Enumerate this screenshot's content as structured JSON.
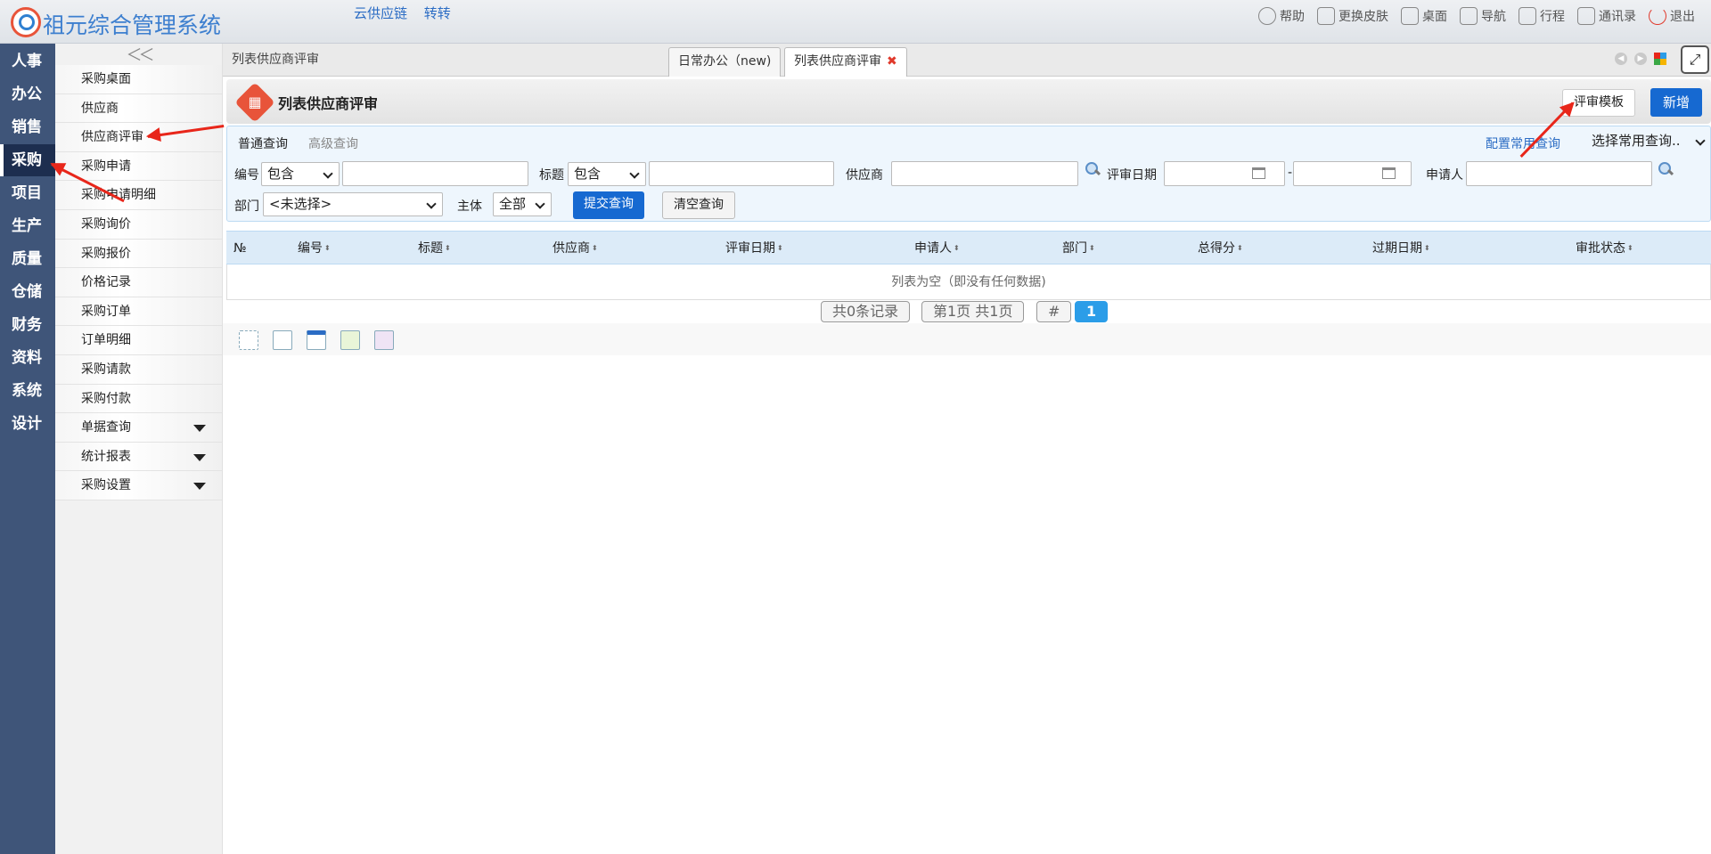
{
  "app": {
    "title": "祖元综合管理系统"
  },
  "top_links": [
    "云供应链",
    "转转"
  ],
  "top_actions": [
    {
      "label": "帮助",
      "icon": "help-icon"
    },
    {
      "label": "更换皮肤",
      "icon": "shirt-icon"
    },
    {
      "label": "桌面",
      "icon": "home-icon"
    },
    {
      "label": "导航",
      "icon": "grid-icon"
    },
    {
      "label": "行程",
      "icon": "calendar-icon"
    },
    {
      "label": "通讯录",
      "icon": "contacts-icon"
    },
    {
      "label": "退出",
      "icon": "power-icon"
    }
  ],
  "main_nav": [
    "人事",
    "办公",
    "销售",
    "采购",
    "项目",
    "生产",
    "质量",
    "仓储",
    "财务",
    "资料",
    "系统",
    "设计"
  ],
  "main_nav_active": "采购",
  "submenu": {
    "collapse_glyph": "＜＜",
    "items": [
      {
        "label": "采购桌面"
      },
      {
        "label": "供应商"
      },
      {
        "label": "供应商评审"
      },
      {
        "label": "采购申请"
      },
      {
        "label": "采购申请明细"
      },
      {
        "label": "采购询价"
      },
      {
        "label": "采购报价"
      },
      {
        "label": "价格记录"
      },
      {
        "label": "采购订单"
      },
      {
        "label": "订单明细"
      },
      {
        "label": "采购请款"
      },
      {
        "label": "采购付款"
      },
      {
        "label": "单据查询"
      },
      {
        "label": "统计报表"
      },
      {
        "label": "采购设置"
      }
    ]
  },
  "tabs": {
    "breadcrumb": "列表供应商评审",
    "items": [
      {
        "label": "日常办公（new)"
      },
      {
        "label": "列表供应商评审",
        "close": "✖"
      }
    ]
  },
  "panel": {
    "title": "列表供应商评审",
    "icon_glyph": "▦",
    "template_button": "评审模板",
    "new_button": "新增"
  },
  "search": {
    "tab_normal": "普通查询",
    "tab_advanced": "高级查询",
    "config_link": "配置常用查询",
    "common_select": "选择常用查询..",
    "code_label": "编号",
    "code_op": "包含",
    "title_label": "标题",
    "title_op": "包含",
    "supplier_label": "供应商",
    "date_label": "评审日期",
    "date_sep": "-",
    "applicant_label": "申请人",
    "dept_label": "部门",
    "dept_value": "<未选择>",
    "subject_label": "主体",
    "subject_value": "全部",
    "submit": "提交查询",
    "clear": "清空查询"
  },
  "grid": {
    "columns": [
      "№",
      "编号",
      "标题",
      "供应商",
      "评审日期",
      "申请人",
      "部门",
      "总得分",
      "过期日期",
      "审批状态"
    ],
    "sort_glyph": "⬍",
    "empty_text": "列表为空（即没有任何数据)"
  },
  "pager": {
    "total": "共0条记录",
    "page_info": "第1页 共1页",
    "hash": "#",
    "current": "1"
  },
  "colors": {
    "nav_bg": "#3f5579",
    "nav_active": "#1d2e4f",
    "accent_blue": "#1669d1",
    "logo_red": "#e8543a",
    "arrow_red": "#e8261a"
  }
}
